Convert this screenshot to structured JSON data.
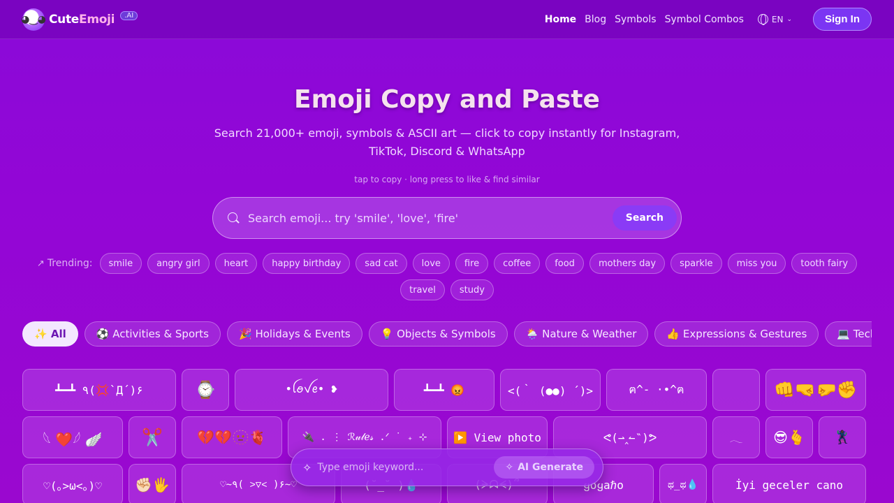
{
  "header": {
    "logo_main": "Cute",
    "logo_accent": "Emoji",
    "logo_badge": ".AI",
    "nav": [
      "Home",
      "Blog",
      "Symbols",
      "Symbol Combos"
    ],
    "language": "EN",
    "sign_in": "Sign In"
  },
  "hero": {
    "title": "Emoji Copy and Paste",
    "subtitle": "Search 21,000+ emoji, symbols & ASCII art — click to copy instantly for Instagram, TikTok, Discord & WhatsApp",
    "hint": "tap to copy · long press to like & find similar"
  },
  "search": {
    "placeholder": "Search emoji... try 'smile', 'love', 'fire'",
    "button": "Search"
  },
  "trending": {
    "label": "Trending:",
    "tags": [
      "smile",
      "angry girl",
      "heart",
      "happy birthday",
      "sad cat",
      "love",
      "fire",
      "coffee",
      "food",
      "mothers day",
      "sparkle",
      "miss you",
      "tooth fairy",
      "travel",
      "study"
    ]
  },
  "categories": [
    "✨ All",
    "⚽ Activities & Sports",
    "🎉 Holidays & Events",
    "💡 Objects & Symbols",
    "🌦️ Nature & Weather",
    "👍 Expressions & Gestures",
    "💻 Tech & Internet"
  ],
  "grid": [
    "┻━┻ ٩(💢`Д´)۶",
    "⌚",
    "•ꪶꪮꪜꫀ• ❥",
    "┻━┻ 😡",
    "<(｀ (●●) ´)>",
    "ฅ^- ·•^ฅ",
    "",
    "👊🤜🤛✊",
    "𓆩 ❤️𓆪 🪽",
    "✂️",
    "💔💔🫥🫀",
    "🔌 . ⋮ ℛ𝓊𝓁ℯ𝓈 .ᐟ ˙ ₊ ⊹",
    "▶️ View photo",
    "ᕙ(⇀‸↼‶)ᕗ",
    "𓂃",
    "😎🫰",
    "🦹🏿‍♀️",
    "♡(｡>ω<｡)♡",
    "✊🏻🖐️",
    "♡~٩( ˃▽˂ )۶~♡",
    "(˘_˘ )💧",
    "(ᗒᗣᗕ)՞",
    "ყoყaℏo",
    "ಥ_ಥ💧",
    "İyi geceler cano"
  ],
  "ai": {
    "placeholder": "Type emoji keyword...",
    "button": "AI Generate"
  }
}
